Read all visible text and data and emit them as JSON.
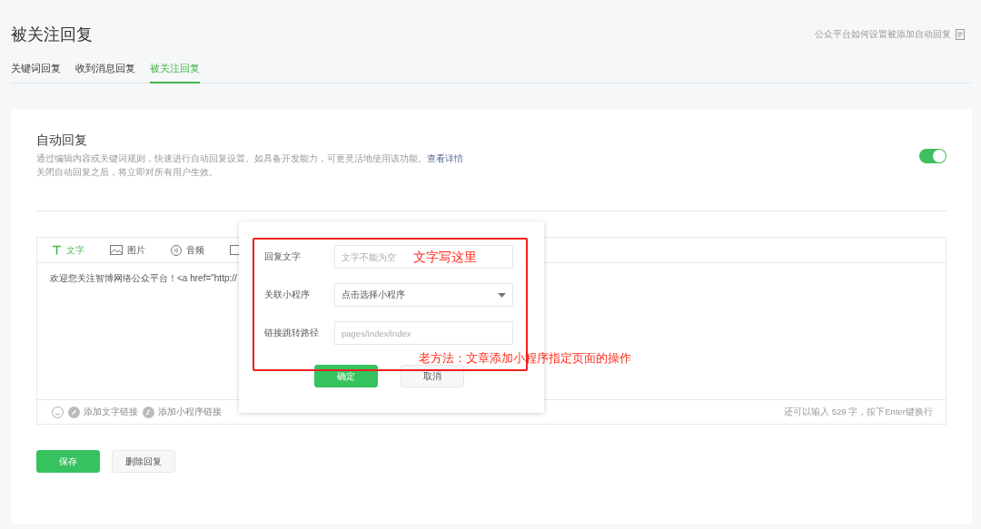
{
  "page": {
    "title": "被关注回复",
    "help_link": "公众平台如何设置被添加自动回复"
  },
  "tabs": [
    {
      "label": "关键词回复",
      "selected": false
    },
    {
      "label": "收到消息回复",
      "selected": false
    },
    {
      "label": "被关注回复",
      "selected": true
    }
  ],
  "auto_reply": {
    "title": "自动回复",
    "description": "通过编辑内容或关键词规则，快速进行自动回复设置。如具备开发能力，可更灵活地使用该功能。",
    "details_link": "查看详情",
    "note": "关闭自动回复之后，将立即对所有用户生效。",
    "on": true
  },
  "editor": {
    "tabs": [
      {
        "kind": "text",
        "label": "文字",
        "selected": true
      },
      {
        "kind": "image",
        "label": "图片",
        "selected": false
      },
      {
        "kind": "audio",
        "label": "音频",
        "selected": false
      },
      {
        "kind": "video",
        "selected": false
      }
    ],
    "content": "欢迎您关注智博网络公众平台！<a href=\"http://",
    "footer_actions": [
      {
        "kind": "emoji"
      },
      {
        "kind": "link",
        "label": "添加文字链接"
      },
      {
        "kind": "miniprogram",
        "label": "添加小程序链接"
      }
    ],
    "counter": "还可以输入 529 字，按下Enter键换行"
  },
  "buttons": [
    {
      "kind": "primary",
      "label": "保存"
    },
    {
      "kind": "secondary",
      "label": "删除回复"
    }
  ],
  "dialog": {
    "fields": [
      {
        "kind": "input",
        "label": "回复文字",
        "placeholder": "文字不能为空"
      },
      {
        "kind": "select",
        "label": "关联小程序",
        "value": "点击选择小程序"
      },
      {
        "kind": "input",
        "label": "链接跳转路径",
        "placeholder": "pages/index/index"
      }
    ],
    "buttons": [
      {
        "kind": "primary",
        "label": "确定"
      },
      {
        "kind": "secondary",
        "label": "取消"
      }
    ]
  },
  "annotations": [
    {
      "text": "文字写这里"
    },
    {
      "text": "老方法：文章添加小程序指定页面的操作"
    }
  ]
}
